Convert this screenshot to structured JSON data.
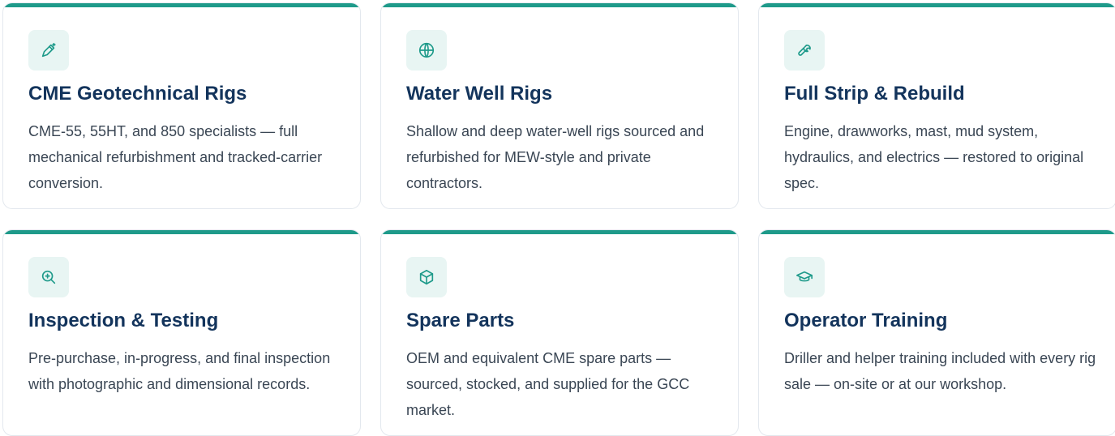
{
  "cards": [
    {
      "icon": "pen-sparkle-icon",
      "title": "CME Geotechnical Rigs",
      "description": "CME-55, 55HT, and 850 specialists — full mechanical refurbishment and tracked-carrier conversion."
    },
    {
      "icon": "globe-icon",
      "title": "Water Well Rigs",
      "description": "Shallow and deep water-well rigs sourced and refurbished for MEW-style and private contractors."
    },
    {
      "icon": "wrench-icon",
      "title": "Full Strip & Rebuild",
      "description": "Engine, drawworks, mast, mud system, hydraulics, and electrics — restored to original spec."
    },
    {
      "icon": "zoom-in-icon",
      "title": "Inspection & Testing",
      "description": "Pre-purchase, in-progress, and final inspection with photographic and dimensional records."
    },
    {
      "icon": "cube-icon",
      "title": "Spare Parts",
      "description": "OEM and equivalent CME spare parts — sourced, stocked, and supplied for the GCC market."
    },
    {
      "icon": "graduation-cap-icon",
      "title": "Operator Training",
      "description": "Driller and helper training included with every rig sale — on-site or at our workshop."
    }
  ],
  "colors": {
    "accent": "#1e9a8a",
    "icon_bg": "#e8f5f3",
    "title": "#13345c",
    "body": "#3a4654",
    "border": "#e3e8ee"
  }
}
